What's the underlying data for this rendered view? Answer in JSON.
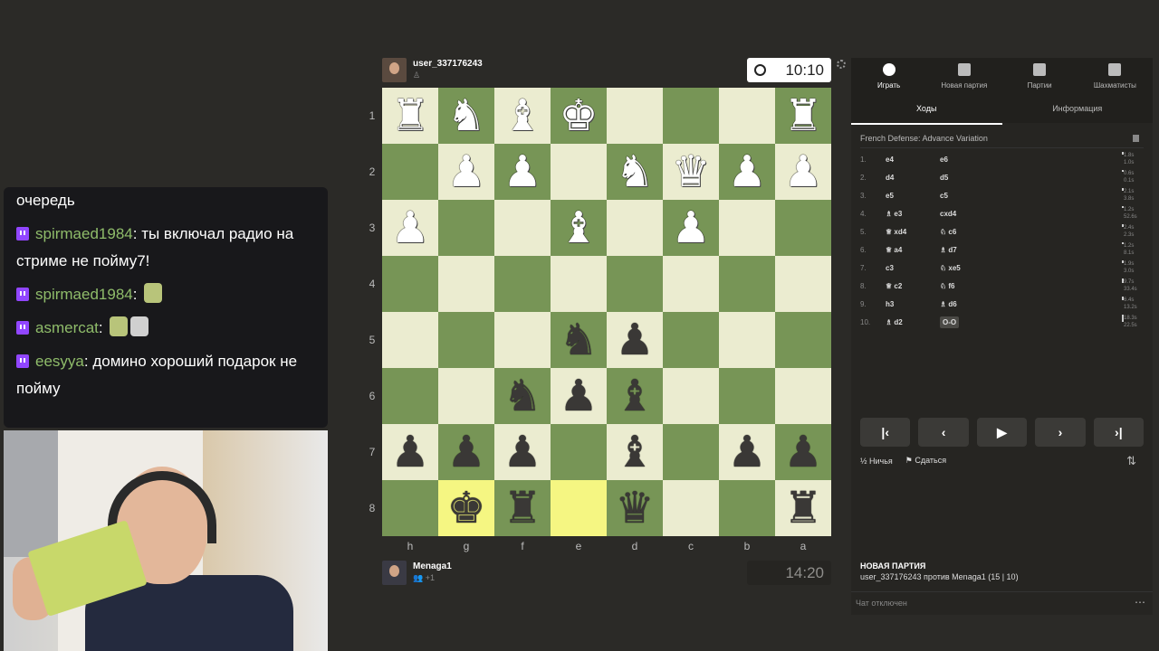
{
  "chat": {
    "messages": [
      {
        "user": "",
        "text": "очередь"
      },
      {
        "user": "spirmaed1984",
        "text": "ты включал радио на стриме не пойму7!"
      },
      {
        "user": "spirmaed1984",
        "text": "",
        "emotes": 1
      },
      {
        "user": "asmercat",
        "text": "",
        "emotes": 2
      },
      {
        "user": "eesyya",
        "text": "домино хороший подарок не пойму"
      }
    ]
  },
  "top_player": {
    "name": "user_337176243",
    "clock": "10:10"
  },
  "bottom_player": {
    "name": "Menaga1",
    "sub": "+1",
    "clock": "14:20"
  },
  "ranks": [
    "1",
    "2",
    "3",
    "4",
    "5",
    "6",
    "7",
    "8"
  ],
  "files": [
    "h",
    "g",
    "f",
    "e",
    "d",
    "c",
    "b",
    "a"
  ],
  "board": [
    [
      "R",
      "N",
      "B",
      "K",
      "",
      "",
      "",
      "R"
    ],
    [
      "",
      "P",
      "P",
      "",
      "N",
      "Q",
      "P",
      "P"
    ],
    [
      "P",
      "",
      "",
      "B",
      "",
      "P",
      "",
      ""
    ],
    [
      "",
      "",
      "",
      "",
      "",
      "",
      "",
      ""
    ],
    [
      "",
      "",
      "",
      "n",
      "p",
      "",
      "",
      ""
    ],
    [
      "",
      "",
      "n",
      "p",
      "b",
      "",
      "",
      ""
    ],
    [
      "p",
      "p",
      "p",
      "",
      "b",
      "",
      "p",
      "p"
    ],
    [
      "",
      "k",
      "r",
      "",
      "q",
      "",
      "",
      "r"
    ]
  ],
  "highlight": [
    "7-1",
    "7-3"
  ],
  "panel": {
    "tabs": [
      {
        "label": "Играть",
        "icon": "stopwatch-icon",
        "active": true
      },
      {
        "label": "Новая партия",
        "icon": "plus-icon"
      },
      {
        "label": "Партии",
        "icon": "board-icon"
      },
      {
        "label": "Шахматисты",
        "icon": "players-icon"
      }
    ],
    "subtabs": [
      "Ходы",
      "Информация"
    ],
    "opening": "French Defense: Advance Variation",
    "moves": [
      {
        "n": "1.",
        "w": "e4",
        "b": "e6",
        "tw": "1.8s",
        "tb": "1.0s"
      },
      {
        "n": "2.",
        "w": "d4",
        "b": "d5",
        "tw": "0.6s",
        "tb": "0.1s"
      },
      {
        "n": "3.",
        "w": "e5",
        "b": "c5",
        "tw": "2.1s",
        "tb": "3.8s"
      },
      {
        "n": "4.",
        "w": "♗ e3",
        "b": "cxd4",
        "tw": "1.2s",
        "tb": "52.6s"
      },
      {
        "n": "5.",
        "w": "♕ xd4",
        "b": "♘ c6",
        "tw": "2.4s",
        "tb": "2.3s"
      },
      {
        "n": "6.",
        "w": "♕ a4",
        "b": "♗ d7",
        "tw": "1.2s",
        "tb": "8.1s"
      },
      {
        "n": "7.",
        "w": "c3",
        "b": "♘ xe5",
        "tw": "1.9s",
        "tb": "3.0s"
      },
      {
        "n": "8.",
        "w": "♕ c2",
        "b": "♘ f6",
        "tw": "9.7s",
        "tb": "33.4s"
      },
      {
        "n": "9.",
        "w": "h3",
        "b": "♗ d6",
        "tw": "6.4s",
        "tb": "13.2s"
      },
      {
        "n": "10.",
        "w": "♗ d2",
        "b": "O-O",
        "tw": "18.3s",
        "tb": "22.5s"
      }
    ],
    "nav": [
      "first-button",
      "prev-button",
      "play-button",
      "next-button",
      "last-button"
    ],
    "draw_label": "Ничья",
    "resign_label": "Сдаться",
    "new_game_title": "НОВАЯ ПАРТИЯ",
    "new_game_desc": "user_337176243 против Menaga1 (15 | 10)",
    "chat_disabled": "Чат отключен"
  }
}
